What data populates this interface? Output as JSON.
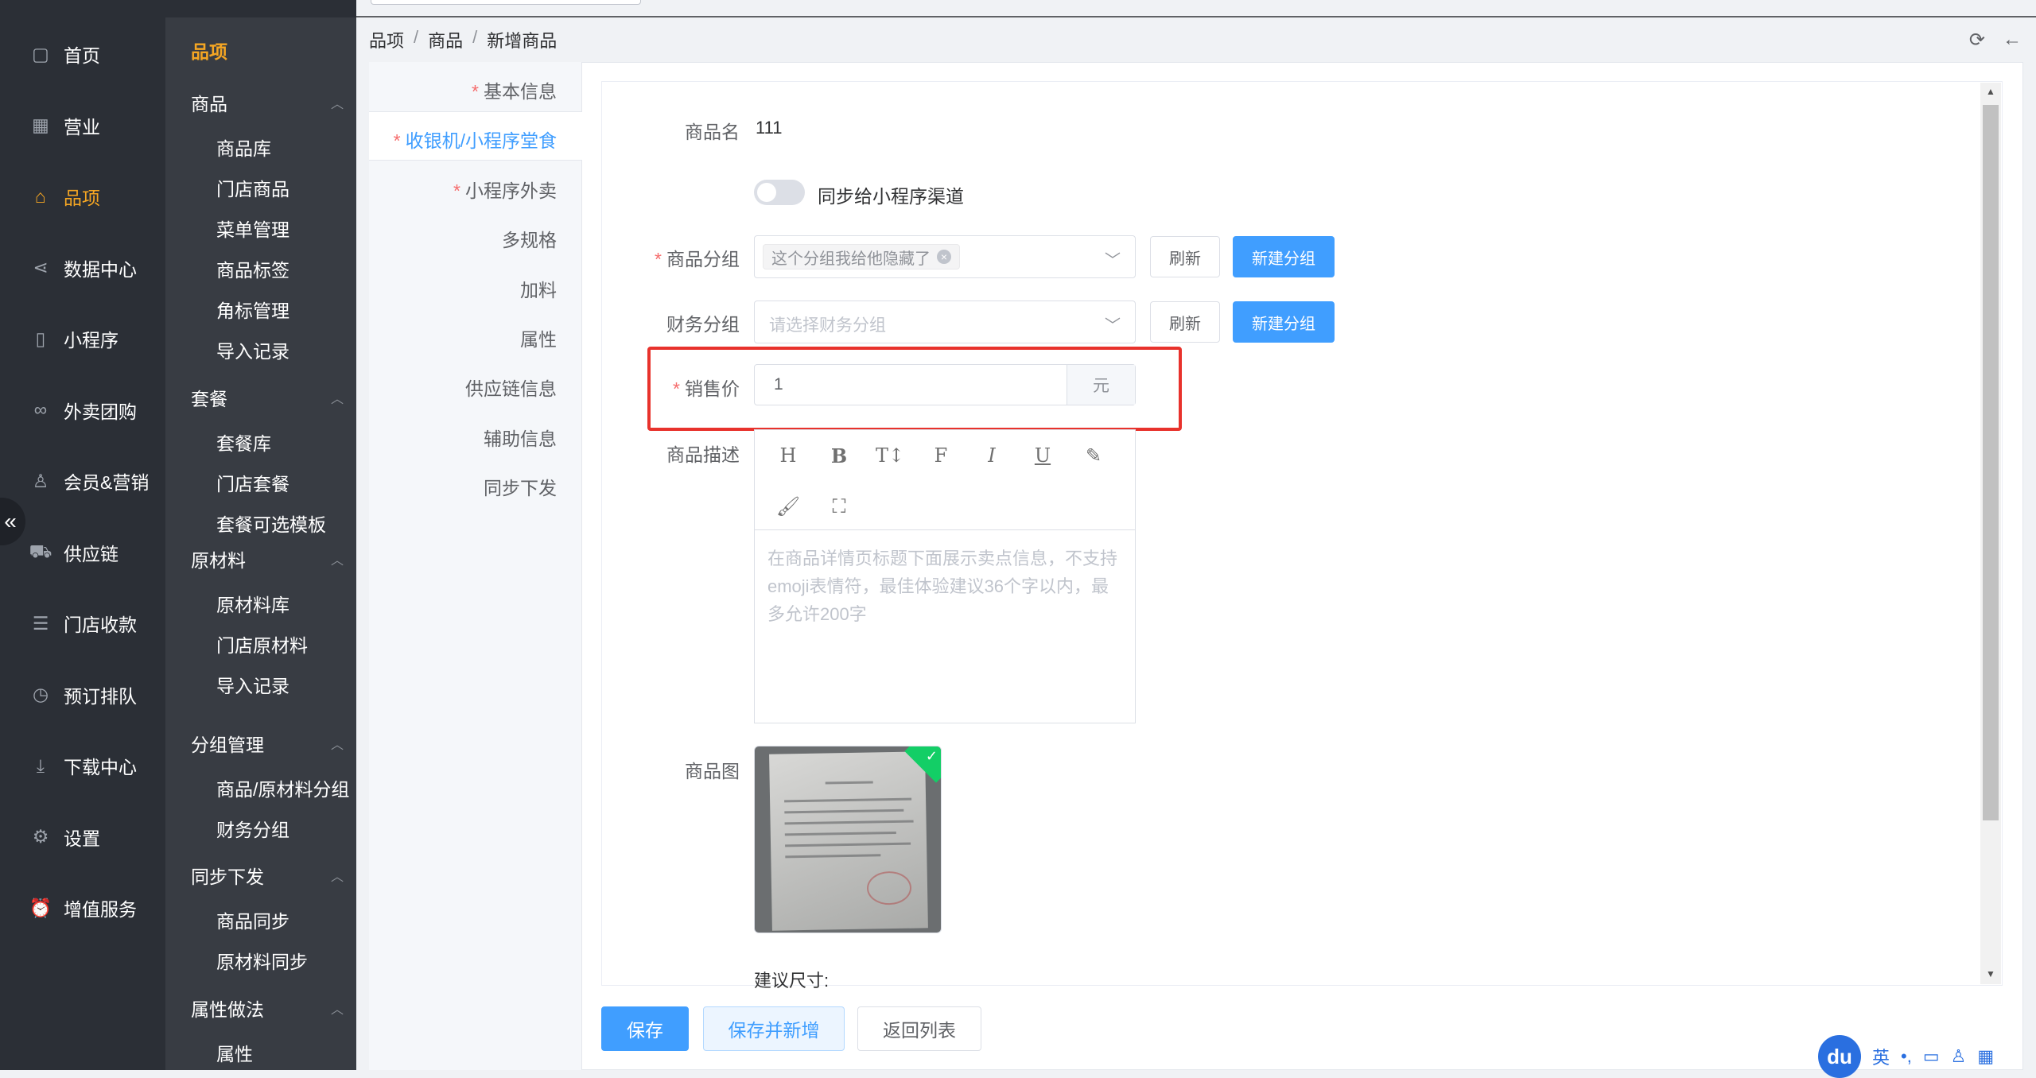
{
  "breadcrumb": [
    "品项",
    "商品",
    "新增商品"
  ],
  "nav_primary": [
    {
      "label": "首页",
      "icon": "home-icon"
    },
    {
      "label": "营业",
      "icon": "calendar-icon"
    },
    {
      "label": "品项",
      "icon": "bag-icon",
      "active": true
    },
    {
      "label": "数据中心",
      "icon": "share-icon"
    },
    {
      "label": "小程序",
      "icon": "phone-icon"
    },
    {
      "label": "外卖团购",
      "icon": "bike-icon"
    },
    {
      "label": "会员&营销",
      "icon": "user-icon"
    },
    {
      "label": "供应链",
      "icon": "truck-icon"
    },
    {
      "label": "门店收款",
      "icon": "database-icon"
    },
    {
      "label": "预订排队",
      "icon": "clock-icon"
    },
    {
      "label": "下载中心",
      "icon": "download-icon"
    },
    {
      "label": "设置",
      "icon": "gear-icon"
    },
    {
      "label": "增值服务",
      "icon": "alarm-icon"
    }
  ],
  "nav_secondary": {
    "title": "品项",
    "groups": [
      {
        "label": "商品",
        "items": [
          "商品库",
          "门店商品",
          "菜单管理",
          "商品标签",
          "角标管理",
          "导入记录"
        ]
      },
      {
        "label": "套餐",
        "items": [
          "套餐库",
          "门店套餐",
          "套餐可选模板"
        ]
      },
      {
        "label": "原材料",
        "items": [
          "原材料库",
          "门店原材料",
          "导入记录"
        ]
      },
      {
        "label": "分组管理",
        "items": [
          "商品/原材料分组",
          "财务分组"
        ]
      },
      {
        "label": "同步下发",
        "items": [
          "商品同步",
          "原材料同步"
        ]
      },
      {
        "label": "属性做法",
        "items": [
          "属性"
        ]
      }
    ]
  },
  "tabs": [
    {
      "label": "基本信息",
      "required": "*"
    },
    {
      "label": "收银机/小程序堂食",
      "required": "*",
      "active": true
    },
    {
      "label": "小程序外卖",
      "required": "*"
    },
    {
      "label": "多规格"
    },
    {
      "label": "加料"
    },
    {
      "label": "属性"
    },
    {
      "label": "供应链信息"
    },
    {
      "label": "辅助信息"
    },
    {
      "label": "同步下发"
    }
  ],
  "form": {
    "name_label": "商品名",
    "name_value": "111",
    "sync_label": "同步给小程序渠道",
    "sync_on": false,
    "group_label": "商品分组",
    "group_tag": "这个分组我给他隐藏了",
    "refresh_label": "刷新",
    "new_group_label": "新建分组",
    "finance_label": "财务分组",
    "finance_placeholder": "请选择财务分组",
    "price_label": "销售价",
    "price_value": "1",
    "price_unit": "元",
    "desc_label": "商品描述",
    "desc_placeholder": "在商品详情页标题下面展示卖点信息，不支持emoji表情符，最佳体验建议36个字以内，最多允许200字",
    "image_label": "商品图",
    "size_hint": "建议尺寸:",
    "required_mark": "*"
  },
  "editor_tools": [
    {
      "glyph": "H",
      "icon": "heading-icon"
    },
    {
      "glyph": "B",
      "icon": "bold-icon"
    },
    {
      "glyph": "T↕",
      "icon": "font-size-icon"
    },
    {
      "glyph": "F",
      "icon": "font-family-icon"
    },
    {
      "glyph": "I",
      "icon": "italic-icon"
    },
    {
      "glyph": "U",
      "icon": "underline-icon"
    },
    {
      "glyph": "✎",
      "icon": "highlight-icon"
    },
    {
      "glyph": "🖌",
      "icon": "brush-icon"
    },
    {
      "glyph": "⛶",
      "icon": "fullscreen-icon"
    }
  ],
  "actions": {
    "save": "保存",
    "save_new": "保存并新增",
    "back": "返回列表"
  },
  "ime": {
    "logo": "du",
    "lang": "英",
    "punct": "•,"
  },
  "colors": {
    "accent": "#409eff",
    "nav_active": "#f5a623",
    "highlight_box": "#e8322c"
  }
}
